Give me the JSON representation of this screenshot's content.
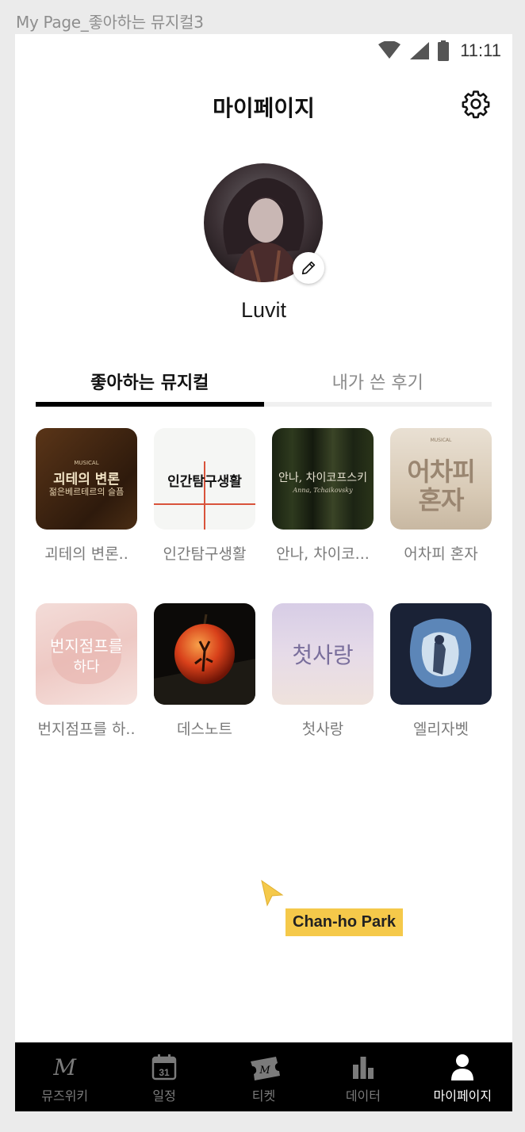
{
  "frame_label": "My Page_좋아하는 뮤지컬3",
  "status_bar": {
    "time": "11:11"
  },
  "header": {
    "title": "마이페이지"
  },
  "profile": {
    "username": "Luvit"
  },
  "tabs": [
    {
      "label": "좋아하는 뮤지컬",
      "active": true
    },
    {
      "label": "내가 쓴 후기",
      "active": false
    }
  ],
  "liked_musicals": [
    {
      "title": "괴테의 변론..",
      "poster_text": [
        "괴테의 변론",
        "젊은베르테르의 슬픔"
      ],
      "poster_small": "MUSICAL"
    },
    {
      "title": "인간탐구생활",
      "poster_text": [
        "인간탐구생활"
      ]
    },
    {
      "title": "안나, 차이코...",
      "poster_text": [
        "안나, 차이코프스키"
      ],
      "poster_small": "Anna, Tchaikovsky"
    },
    {
      "title": "어차피 혼자",
      "poster_text": [
        "어차피",
        "혼자"
      ],
      "poster_small": "MUSICAL"
    },
    {
      "title": "번지점프를 하..",
      "poster_text": [
        "번지점프를",
        "하다"
      ]
    },
    {
      "title": "데스노트",
      "poster_text": []
    },
    {
      "title": "첫사랑",
      "poster_text": [
        "첫사랑"
      ]
    },
    {
      "title": "엘리자벳",
      "poster_text": []
    }
  ],
  "overlay": {
    "presenter_name": "Chan-ho Park"
  },
  "bottom_nav": [
    {
      "label": "뮤즈위키",
      "icon": "muse-logo-icon",
      "glyph": "M"
    },
    {
      "label": "일정",
      "icon": "calendar-icon",
      "glyph": "31"
    },
    {
      "label": "티켓",
      "icon": "ticket-icon",
      "glyph": "M"
    },
    {
      "label": "데이터",
      "icon": "bar-chart-icon"
    },
    {
      "label": "마이페이지",
      "icon": "person-icon",
      "active": true
    }
  ],
  "colors": {
    "accent": "#000000",
    "tab_inactive": "#8a8a8a",
    "presenter_tag": "#f5c94a",
    "nav_bg": "#000000"
  }
}
